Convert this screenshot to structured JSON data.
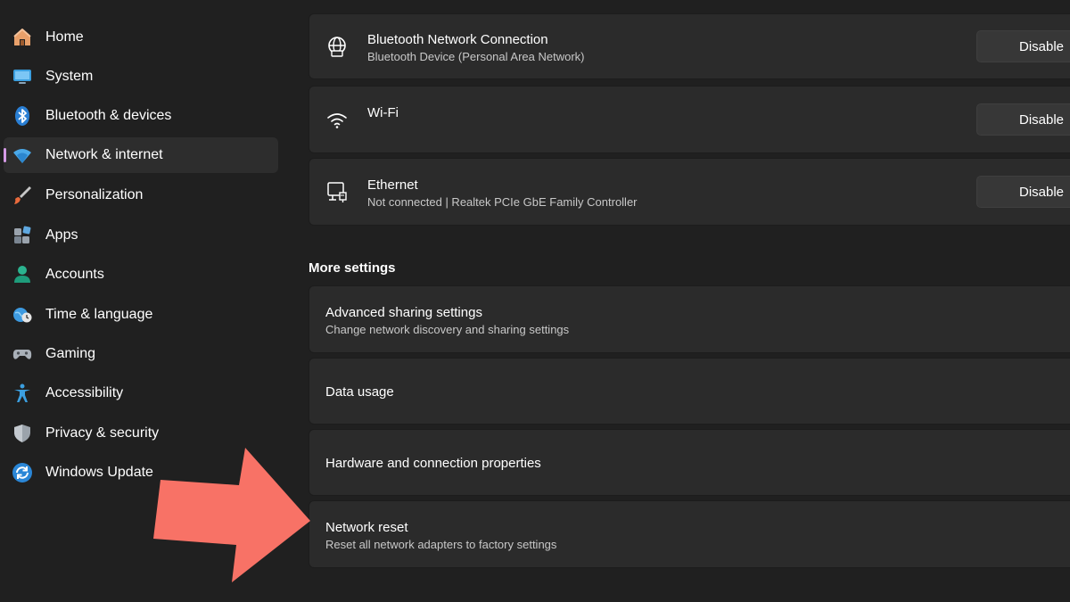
{
  "sidebar": {
    "items": [
      {
        "label": "Home",
        "icon": "home-icon",
        "selected": false
      },
      {
        "label": "System",
        "icon": "system-monitor-icon",
        "selected": false
      },
      {
        "label": "Bluetooth & devices",
        "icon": "bluetooth-icon",
        "selected": false
      },
      {
        "label": "Network & internet",
        "icon": "wifi-icon",
        "selected": true
      },
      {
        "label": "Personalization",
        "icon": "paintbrush-icon",
        "selected": false
      },
      {
        "label": "Apps",
        "icon": "apps-icon",
        "selected": false
      },
      {
        "label": "Accounts",
        "icon": "person-icon",
        "selected": false
      },
      {
        "label": "Time & language",
        "icon": "globe-clock-icon",
        "selected": false
      },
      {
        "label": "Gaming",
        "icon": "gamepad-icon",
        "selected": false
      },
      {
        "label": "Accessibility",
        "icon": "accessibility-icon",
        "selected": false
      },
      {
        "label": "Privacy & security",
        "icon": "shield-icon",
        "selected": false
      },
      {
        "label": "Windows Update",
        "icon": "update-icon",
        "selected": false
      }
    ]
  },
  "main": {
    "adapters": [
      {
        "title": "Bluetooth Network Connection",
        "subtitle": "Bluetooth Device (Personal Area Network)",
        "icon": "globe-network-icon",
        "button": "Disable"
      },
      {
        "title": "Wi-Fi",
        "subtitle": "",
        "icon": "wifi-icon",
        "button": "Disable"
      },
      {
        "title": "Ethernet",
        "subtitle": "Not connected | Realtek PCIe GbE Family Controller",
        "icon": "ethernet-icon",
        "button": "Disable"
      }
    ],
    "more_settings_heading": "More settings",
    "more_settings": [
      {
        "title": "Advanced sharing settings",
        "subtitle": "Change network discovery and sharing settings"
      },
      {
        "title": "Data usage",
        "subtitle": ""
      },
      {
        "title": "Hardware and connection properties",
        "subtitle": ""
      },
      {
        "title": "Network reset",
        "subtitle": "Reset all network adapters to factory settings"
      }
    ]
  },
  "colors": {
    "background": "#202020",
    "card": "#2b2b2b",
    "selected_accent": "#d59ae6",
    "annotation_arrow": "#f87266"
  }
}
